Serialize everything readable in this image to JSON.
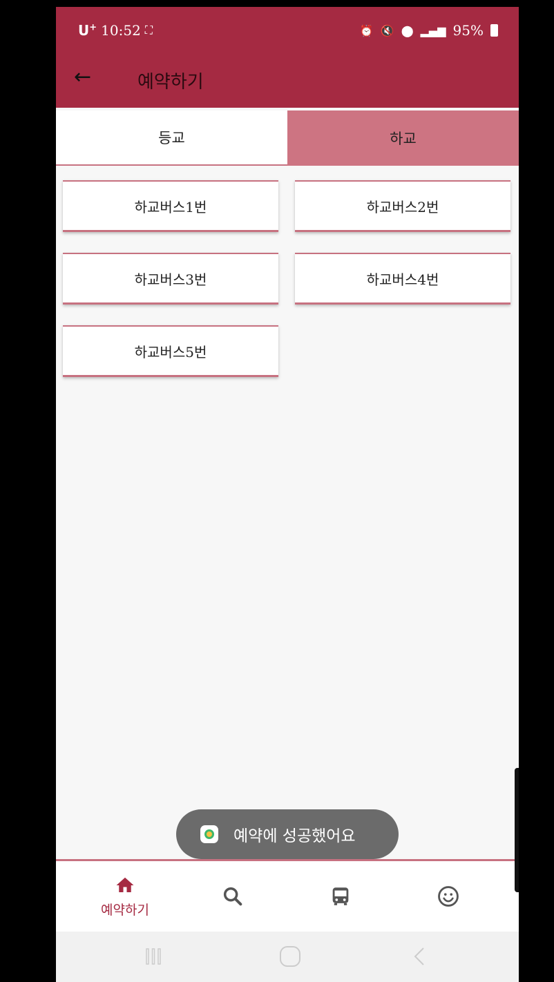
{
  "status": {
    "carrier": "U",
    "carrier_sup": "+",
    "time": "10:52",
    "battery": "95%"
  },
  "appbar": {
    "title": "예약하기"
  },
  "tabs": [
    {
      "label": "등교",
      "selected": true
    },
    {
      "label": "하교",
      "selected": false
    }
  ],
  "buses": [
    "하교버스1번",
    "하교버스2번",
    "하교버스3번",
    "하교버스4번",
    "하교버스5번"
  ],
  "toast": {
    "text": "예약에 성공했어요"
  },
  "bottom_nav": [
    {
      "icon": "home-icon",
      "label": "예약하기",
      "active": true
    },
    {
      "icon": "search-icon",
      "label": "",
      "active": false
    },
    {
      "icon": "bus-icon",
      "label": "",
      "active": false
    },
    {
      "icon": "smiley-icon",
      "label": "",
      "active": false
    }
  ],
  "colors": {
    "primary": "#a52a42",
    "accent": "#cd7482",
    "background": "#f7f7f7"
  }
}
